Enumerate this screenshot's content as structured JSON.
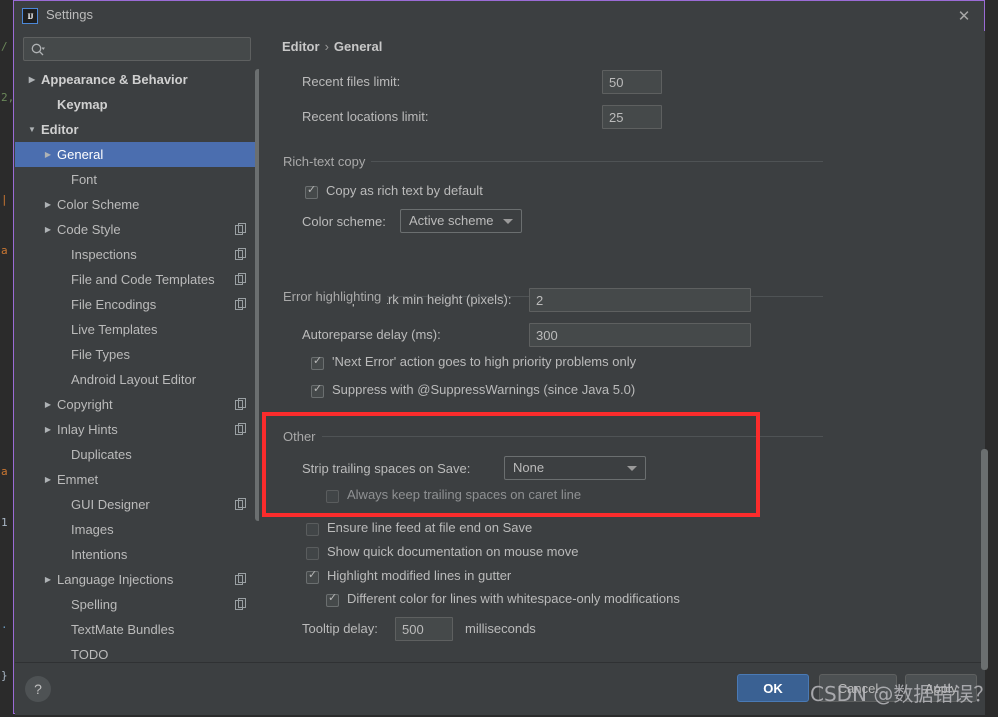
{
  "window": {
    "title": "Settings",
    "app_icon": "IJ",
    "close_icon": "✕"
  },
  "search": {
    "placeholder": "",
    "value": "",
    "icon": "search-icon"
  },
  "sidebar": {
    "items": [
      {
        "label": "Appearance & Behavior",
        "arrow": "▶",
        "indent": 12,
        "bold": true,
        "selected": false,
        "copy": false
      },
      {
        "label": "Keymap",
        "arrow": "",
        "indent": 28,
        "bold": true,
        "selected": false,
        "copy": false
      },
      {
        "label": "Editor",
        "arrow": "▼",
        "indent": 12,
        "bold": true,
        "selected": false,
        "copy": false
      },
      {
        "label": "General",
        "arrow": "▶",
        "indent": 28,
        "bold": false,
        "selected": true,
        "copy": false
      },
      {
        "label": "Font",
        "arrow": "",
        "indent": 42,
        "bold": false,
        "selected": false,
        "copy": false
      },
      {
        "label": "Color Scheme",
        "arrow": "▶",
        "indent": 28,
        "bold": false,
        "selected": false,
        "copy": false
      },
      {
        "label": "Code Style",
        "arrow": "▶",
        "indent": 28,
        "bold": false,
        "selected": false,
        "copy": true
      },
      {
        "label": "Inspections",
        "arrow": "",
        "indent": 42,
        "bold": false,
        "selected": false,
        "copy": true
      },
      {
        "label": "File and Code Templates",
        "arrow": "",
        "indent": 42,
        "bold": false,
        "selected": false,
        "copy": true
      },
      {
        "label": "File Encodings",
        "arrow": "",
        "indent": 42,
        "bold": false,
        "selected": false,
        "copy": true
      },
      {
        "label": "Live Templates",
        "arrow": "",
        "indent": 42,
        "bold": false,
        "selected": false,
        "copy": false
      },
      {
        "label": "File Types",
        "arrow": "",
        "indent": 42,
        "bold": false,
        "selected": false,
        "copy": false
      },
      {
        "label": "Android Layout Editor",
        "arrow": "",
        "indent": 42,
        "bold": false,
        "selected": false,
        "copy": false
      },
      {
        "label": "Copyright",
        "arrow": "▶",
        "indent": 28,
        "bold": false,
        "selected": false,
        "copy": true
      },
      {
        "label": "Inlay Hints",
        "arrow": "▶",
        "indent": 28,
        "bold": false,
        "selected": false,
        "copy": true
      },
      {
        "label": "Duplicates",
        "arrow": "",
        "indent": 42,
        "bold": false,
        "selected": false,
        "copy": false
      },
      {
        "label": "Emmet",
        "arrow": "▶",
        "indent": 28,
        "bold": false,
        "selected": false,
        "copy": false
      },
      {
        "label": "GUI Designer",
        "arrow": "",
        "indent": 42,
        "bold": false,
        "selected": false,
        "copy": true
      },
      {
        "label": "Images",
        "arrow": "",
        "indent": 42,
        "bold": false,
        "selected": false,
        "copy": false
      },
      {
        "label": "Intentions",
        "arrow": "",
        "indent": 42,
        "bold": false,
        "selected": false,
        "copy": false
      },
      {
        "label": "Language Injections",
        "arrow": "▶",
        "indent": 28,
        "bold": false,
        "selected": false,
        "copy": true
      },
      {
        "label": "Spelling",
        "arrow": "",
        "indent": 42,
        "bold": false,
        "selected": false,
        "copy": true
      },
      {
        "label": "TextMate Bundles",
        "arrow": "",
        "indent": 42,
        "bold": false,
        "selected": false,
        "copy": false
      },
      {
        "label": "TODO",
        "arrow": "",
        "indent": 42,
        "bold": false,
        "selected": false,
        "copy": false
      }
    ]
  },
  "breadcrumb": {
    "root": "Editor",
    "separator": "›",
    "leaf": "General"
  },
  "main": {
    "recent_files_label": "Recent files limit:",
    "recent_files_value": "50",
    "recent_locations_label": "Recent locations limit:",
    "recent_locations_value": "25",
    "rich_text_copy_title": "Rich-text copy",
    "copy_rich_text_label": "Copy as rich text by default",
    "copy_rich_text_checked": true,
    "color_scheme_label": "Color scheme:",
    "color_scheme_value": "Active scheme",
    "error_highlighting_title": "Error highlighting",
    "error_stripe_label": "Error stripe mark min height (pixels):",
    "error_stripe_value": "2",
    "autoreparse_label": "Autoreparse delay (ms):",
    "autoreparse_value": "300",
    "next_error_label": "'Next Error' action goes to high priority problems only",
    "next_error_checked": true,
    "suppress_label": "Suppress with @SuppressWarnings (since Java 5.0)",
    "suppress_checked": true,
    "other_title": "Other",
    "strip_trailing_label": "Strip trailing spaces on Save:",
    "strip_trailing_value": "None",
    "always_keep_label": "Always keep trailing spaces on caret line",
    "always_keep_checked": false,
    "ensure_linefeed_label": "Ensure line feed at file end on Save",
    "ensure_linefeed_checked": false,
    "show_quickdoc_label": "Show quick documentation on mouse move",
    "show_quickdoc_checked": false,
    "highlight_modified_label": "Highlight modified lines in gutter",
    "highlight_modified_checked": true,
    "different_color_label": "Different color for lines with whitespace-only modifications",
    "different_color_checked": true,
    "tooltip_delay_label": "Tooltip delay:",
    "tooltip_delay_value": "500",
    "tooltip_delay_unit": "milliseconds"
  },
  "footer": {
    "help_icon": "?",
    "ok_label": "OK",
    "cancel_label": "Cancel",
    "apply_label": "Apply"
  },
  "overlay": {
    "watermark": "CSDN @数据错误？",
    "highlight_color": "#fb2c2c"
  },
  "background_code": [
    "/",
    "2,",
    "|",
    "a",
    "",
    "",
    "",
    "",
    "a",
    "1",
    "",
    "}"
  ]
}
